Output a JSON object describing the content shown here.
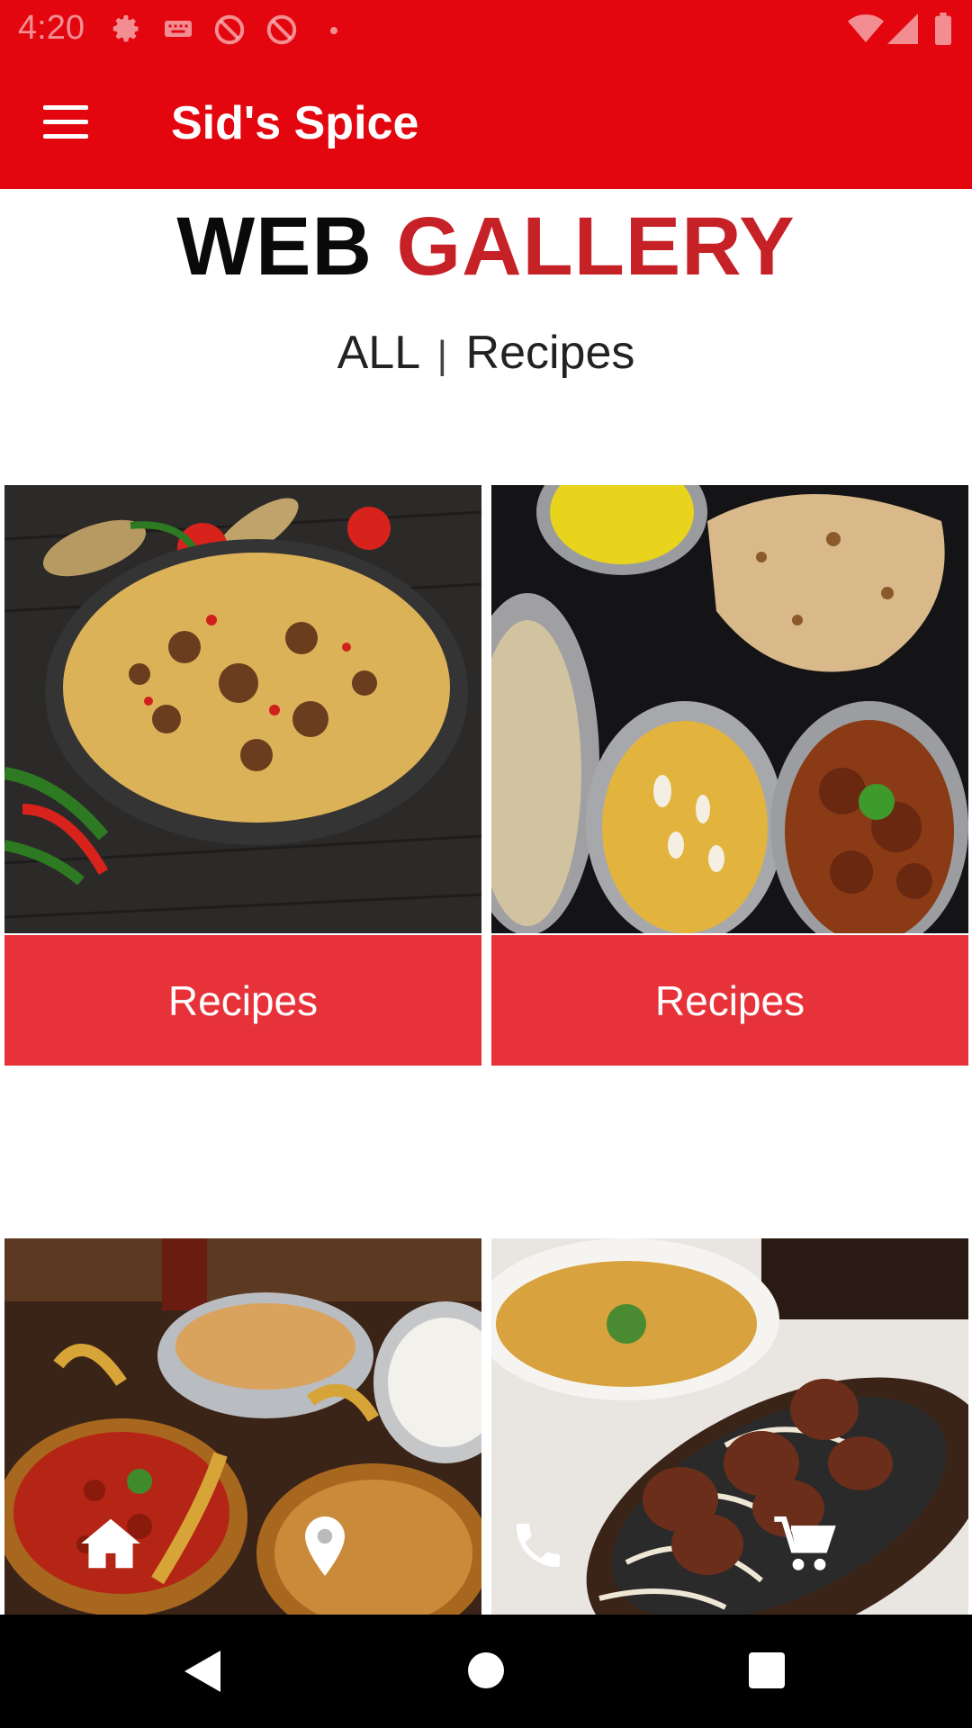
{
  "status_bar": {
    "time": "4:20",
    "icons": [
      "settings-icon",
      "keyboard-icon",
      "no-location-icon",
      "no-location-icon",
      "dot-icon",
      "wifi-icon",
      "signal-icon",
      "battery-icon"
    ]
  },
  "toolbar": {
    "title": "Sid's Spice",
    "menu_icon": "hamburger-menu-icon"
  },
  "heading": {
    "word1": "WEB",
    "word2": "GALLERY"
  },
  "filter": {
    "all": "ALL",
    "separator": "|",
    "recipes": "Recipes"
  },
  "cards": [
    {
      "label": "Recipes",
      "image": "biryani-pan-photo"
    },
    {
      "label": "Recipes",
      "image": "curries-and-naan-photo"
    },
    {
      "label": "",
      "image": "indian-thali-photo"
    },
    {
      "label": "",
      "image": "sizzler-kebab-photo"
    }
  ],
  "bottom_actions": [
    "home-icon",
    "location-pin-icon",
    "phone-icon",
    "cart-icon"
  ],
  "colors": {
    "primary": "#e3060f",
    "heading_accent": "#c62127",
    "card_button": "#e8323a"
  }
}
